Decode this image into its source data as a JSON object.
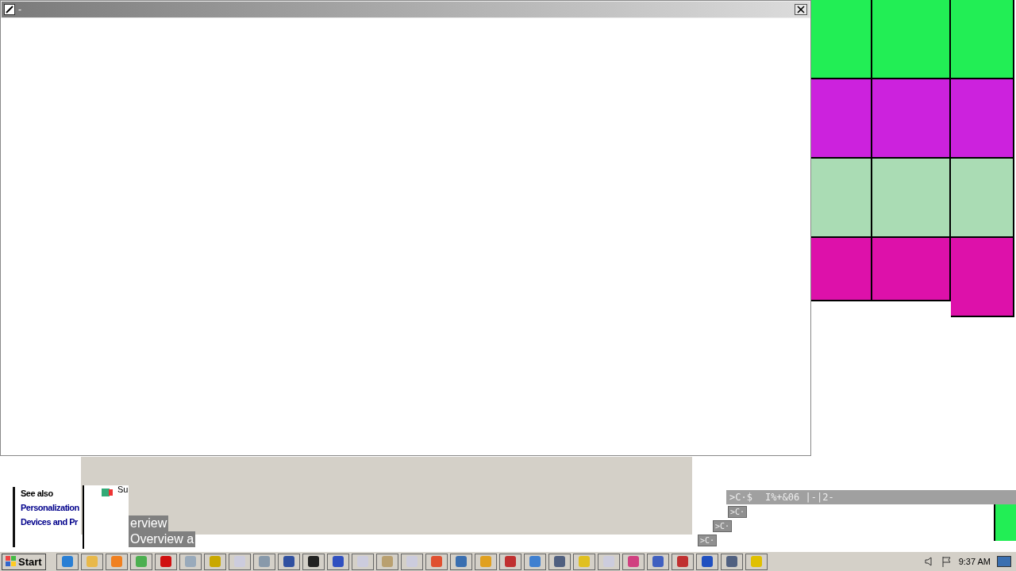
{
  "window": {
    "title": "-"
  },
  "tiles": {
    "rows": [
      {
        "color": "#22ee55"
      },
      {
        "color": "#cc22dd"
      },
      {
        "color": "#aadcb4"
      },
      {
        "color": "#dd11aa"
      }
    ]
  },
  "help_panel": {
    "heading": "See also",
    "links": [
      "Personalization",
      "Devices and Pr"
    ]
  },
  "tree_label": "Su",
  "overview_labels": [
    "erview",
    "Overview a"
  ],
  "garbled_bar": {
    "texts": [
      ">C·$",
      "I%+&06 |-|2-"
    ]
  },
  "small_labels": [
    ">C·",
    ">C·",
    ">C·"
  ],
  "taskbar": {
    "start": "Start",
    "clock": "9:37 AM"
  }
}
